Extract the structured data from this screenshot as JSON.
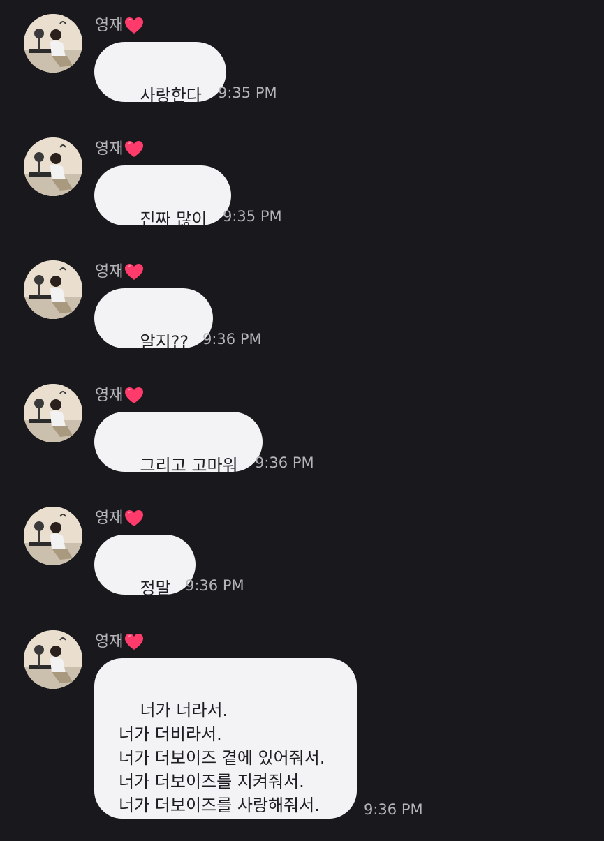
{
  "chat": {
    "messages": [
      {
        "sender": "영재",
        "text": "사랑한다",
        "time": "9:35 PM"
      },
      {
        "sender": "영재",
        "text": "진짜 많이",
        "time": "9:35 PM"
      },
      {
        "sender": "영재",
        "text": "알지??",
        "time": "9:36 PM"
      },
      {
        "sender": "영재",
        "text": "그리고 고마워",
        "time": "9:36 PM"
      },
      {
        "sender": "영재",
        "text": "정말",
        "time": "9:36 PM"
      },
      {
        "sender": "영재",
        "text": "너가 너라서.\n너가 더비라서.\n너가 더보이즈 곁에 있어줘서.\n너가 더보이즈를 지켜줘서.\n너가 더보이즈를 사랑해줘서.",
        "time": "9:36 PM"
      }
    ]
  },
  "icons": {
    "sender_badge": "red-heart-emoji",
    "avatar": "profile-photo"
  },
  "colors": {
    "background": "#18181d",
    "bubble": "#f3f3f5",
    "bubble_text": "#1d1d22",
    "meta_text": "#b4b4b9",
    "heart": "#ff3b6b"
  }
}
